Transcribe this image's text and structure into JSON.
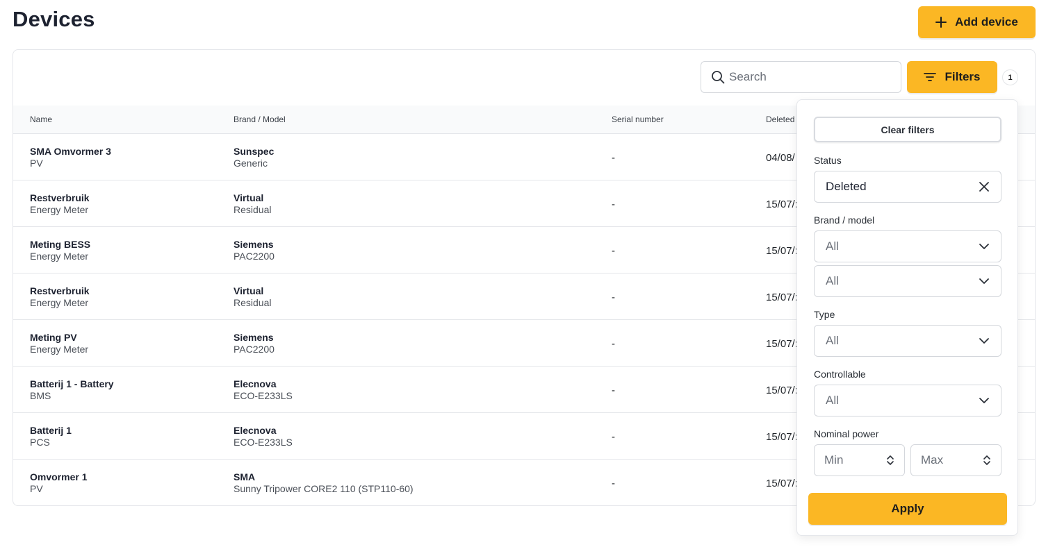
{
  "page": {
    "title": "Devices"
  },
  "toolbar": {
    "add_device_label": "Add device",
    "search_placeholder": "Search",
    "filters_label": "Filters",
    "filters_count": "1"
  },
  "table": {
    "columns": [
      "Name",
      "Brand / Model",
      "Serial number",
      "Deleted"
    ],
    "rows": [
      {
        "name": "SMA Omvormer 3",
        "type": "PV",
        "brand": "Sunspec",
        "model": "Generic",
        "serial": "-",
        "deleted": "04/08/"
      },
      {
        "name": "Restverbruik",
        "type": "Energy Meter",
        "brand": "Virtual",
        "model": "Residual",
        "serial": "-",
        "deleted": "15/07/:"
      },
      {
        "name": "Meting BESS",
        "type": "Energy Meter",
        "brand": "Siemens",
        "model": "PAC2200",
        "serial": "-",
        "deleted": "15/07/:"
      },
      {
        "name": "Restverbruik",
        "type": "Energy Meter",
        "brand": "Virtual",
        "model": "Residual",
        "serial": "-",
        "deleted": "15/07/:"
      },
      {
        "name": "Meting PV",
        "type": "Energy Meter",
        "brand": "Siemens",
        "model": "PAC2200",
        "serial": "-",
        "deleted": "15/07/:"
      },
      {
        "name": "Batterij 1 - Battery",
        "type": "BMS",
        "brand": "Elecnova",
        "model": "ECO-E233LS",
        "serial": "-",
        "deleted": "15/07/:"
      },
      {
        "name": "Batterij 1",
        "type": "PCS",
        "brand": "Elecnova",
        "model": "ECO-E233LS",
        "serial": "-",
        "deleted": "15/07/:"
      },
      {
        "name": "Omvormer 1",
        "type": "PV",
        "brand": "SMA",
        "model": "Sunny Tripower CORE2 110 (STP110-60)",
        "serial": "-",
        "deleted": "15/07/:"
      }
    ]
  },
  "filter_panel": {
    "clear_label": "Clear filters",
    "status_label": "Status",
    "status_value": "Deleted",
    "brand_model_label": "Brand / model",
    "brand_value": "All",
    "model_value": "All",
    "type_label": "Type",
    "type_value": "All",
    "controllable_label": "Controllable",
    "controllable_value": "All",
    "nominal_power_label": "Nominal power",
    "min_placeholder": "Min",
    "max_placeholder": "Max",
    "apply_label": "Apply"
  },
  "icons": {
    "add": "plus-icon",
    "search": "search-icon",
    "filters": "filter-lines-icon",
    "clear_status": "close-icon",
    "select": "chevron-down-icon",
    "number": "up-down-icon"
  },
  "colors": {
    "accent": "#fbb724",
    "border": "#e4e6ea",
    "text": "#1d2230"
  }
}
